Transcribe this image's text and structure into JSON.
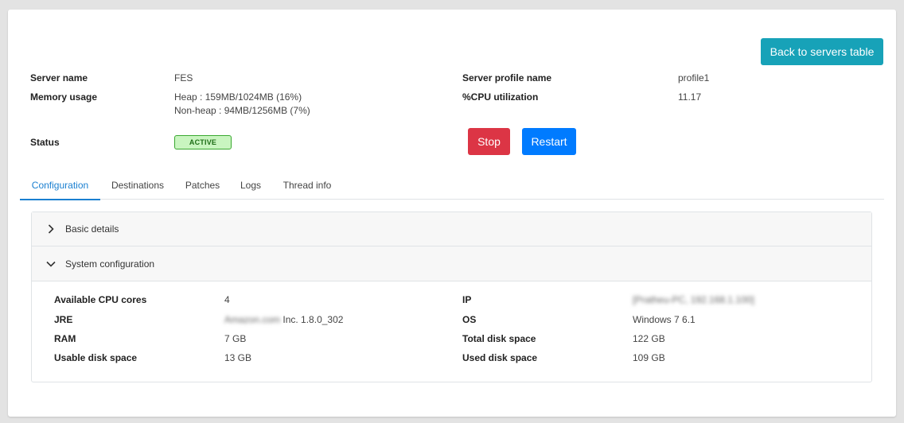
{
  "header": {
    "back_button": "Back to servers table"
  },
  "summary": {
    "server_name_label": "Server name",
    "server_name_value": "FES",
    "memory_label": "Memory usage",
    "memory_heap": "Heap : 159MB/1024MB (16%)",
    "memory_nonheap": "Non-heap : 94MB/1256MB (7%)",
    "status_label": "Status",
    "status_value": "ACTIVE",
    "profile_label": "Server profile name",
    "profile_value": "profile1",
    "cpu_label": "%CPU utilization",
    "cpu_value": "11.17",
    "stop_button": "Stop",
    "restart_button": "Restart"
  },
  "tabs": [
    {
      "label": "Configuration",
      "active": true
    },
    {
      "label": "Destinations",
      "active": false
    },
    {
      "label": "Patches",
      "active": false
    },
    {
      "label": "Logs",
      "active": false
    },
    {
      "label": "Thread info",
      "active": false
    }
  ],
  "accordion": {
    "basic_details": "Basic details",
    "system_configuration": "System configuration"
  },
  "system_config": {
    "cpu_cores_label": "Available CPU cores",
    "cpu_cores_value": "4",
    "jre_label": "JRE",
    "jre_vendor_redacted": "Amazon.com",
    "jre_value": "Inc. 1.8.0_302",
    "ram_label": "RAM",
    "ram_value": "7 GB",
    "usable_disk_label": "Usable disk space",
    "usable_disk_value": "13 GB",
    "ip_label": "IP",
    "ip_value_redacted": "[Pratheu-PC, 192.168.1.100]",
    "os_label": "OS",
    "os_value": "Windows 7 6.1",
    "total_disk_label": "Total disk space",
    "total_disk_value": "122 GB",
    "used_disk_label": "Used disk space",
    "used_disk_value": "109 GB"
  },
  "colors": {
    "back_button": "#17a2b8",
    "stop_button": "#dc3545",
    "restart_button": "#007bff",
    "active_tab": "#1a7fd0",
    "status_badge_bg": "#c9f5c0"
  }
}
